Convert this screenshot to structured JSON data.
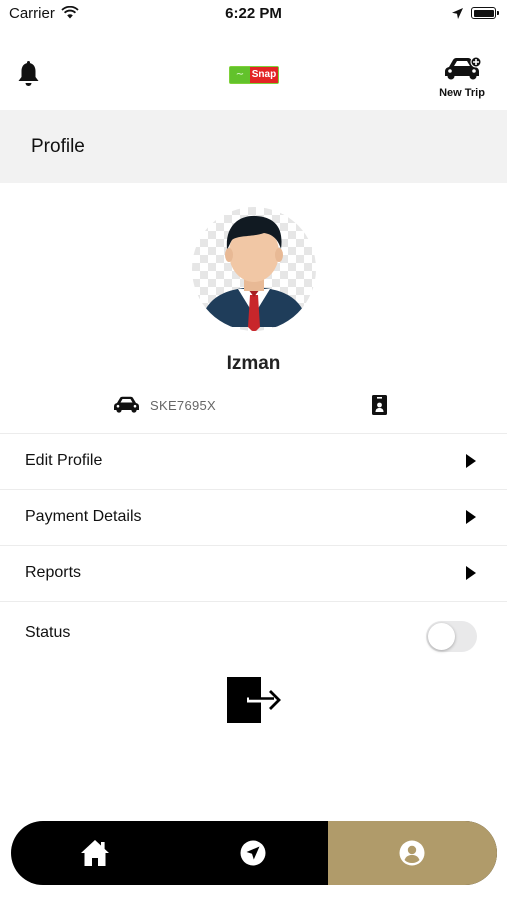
{
  "status_bar": {
    "carrier": "Carrier",
    "time": "6:22 PM"
  },
  "header": {
    "logo_text": "Snap",
    "new_trip_label": "New Trip",
    "page_title": "Profile"
  },
  "profile": {
    "name": "Izman",
    "plate": "SKE7695X"
  },
  "menu": {
    "items": [
      {
        "label": "Edit Profile"
      },
      {
        "label": "Payment Details"
      },
      {
        "label": "Reports"
      }
    ],
    "status_label": "Status",
    "status_on": false
  },
  "tabbar": {
    "tabs": [
      {
        "icon": "home-icon"
      },
      {
        "icon": "navigation-icon"
      },
      {
        "icon": "profile-icon",
        "active": true
      }
    ],
    "active_color": "#b09b6a"
  },
  "colors": {
    "accent": "#b09b6a",
    "header_band": "#f2f2f2"
  }
}
